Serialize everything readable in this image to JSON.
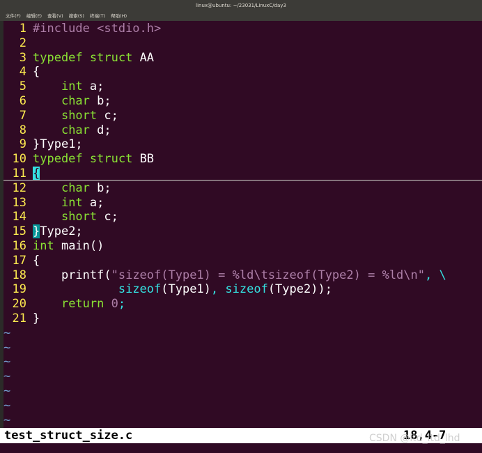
{
  "window": {
    "title": "linux@ubuntu: ~/23031/LinuxC/day3",
    "menu": [
      "文件(F)",
      "编辑(E)",
      "查看(V)",
      "搜索(S)",
      "终端(T)",
      "帮助(H)"
    ]
  },
  "editor": {
    "line_numbers": [
      "1",
      "2",
      "3",
      "4",
      "5",
      "6",
      "7",
      "8",
      "9",
      "10",
      "11",
      "12",
      "13",
      "14",
      "15",
      "16",
      "17",
      "18",
      "19",
      "20",
      "21"
    ],
    "code": {
      "l1_include": "#include <stdio.h>",
      "l3_typedef": "typedef",
      "l3_struct": "struct",
      "l3_name": " AA",
      "brace_open": "{",
      "brace_close": "}",
      "kw_int": "int",
      "kw_char": "char",
      "kw_short": "short",
      "var_a": " a;",
      "var_b": " b;",
      "var_c": " c;",
      "var_d": " d;",
      "indent": "    ",
      "l9_rest": "Type1;",
      "l10_name": " BB",
      "l15_rest": "Type2;",
      "l16_main": " main()",
      "l18_printf": "printf(",
      "l18_str1": "\"sizeof(Type1) = ",
      "l18_fmt1": "%ld",
      "l18_esc1": "\\t",
      "l18_str2": "sizeof(Type2) = ",
      "l18_fmt2": "%ld",
      "l18_esc2": "\\n",
      "l18_str3": "\"",
      "l18_tail": ", \\",
      "l19_indent": "            ",
      "l19_sizeof": "sizeof",
      "l19_arg1": "(Type1)",
      "l19_comma": ", ",
      "l19_arg2": "(Type2));",
      "l20_return": "return",
      "l20_zero": "0",
      "l20_semi": ";"
    },
    "tilde": "~"
  },
  "status": {
    "filename": "test_struct_size.c",
    "position": "18,4-7"
  },
  "watermark": "CSDN @ltd_ltd_lhd"
}
